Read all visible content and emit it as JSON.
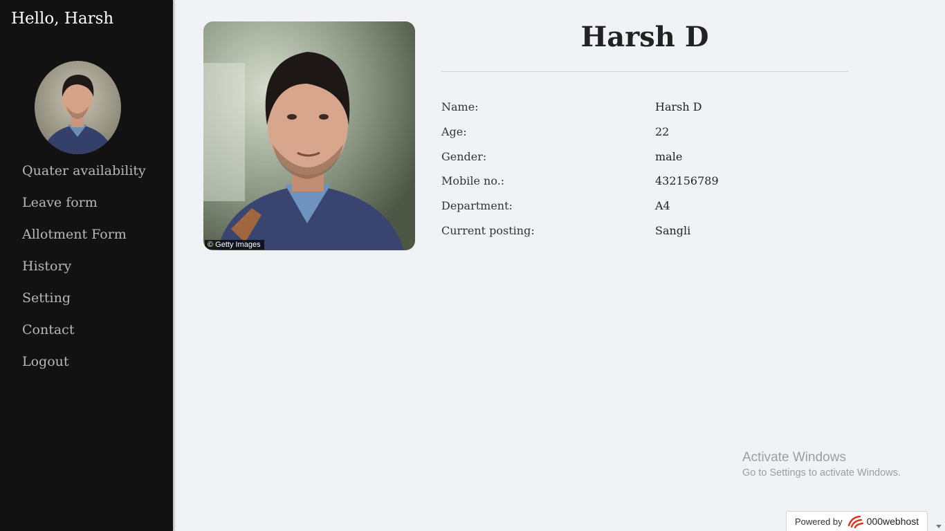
{
  "sidebar": {
    "greeting": "Hello, Harsh",
    "avatar_icon": "user-avatar-photo",
    "nav_items": [
      {
        "label": "Quater availability"
      },
      {
        "label": "Leave form"
      },
      {
        "label": "Allotment Form"
      },
      {
        "label": "History"
      },
      {
        "label": "Setting"
      },
      {
        "label": "Contact"
      },
      {
        "label": "Logout"
      }
    ]
  },
  "profile": {
    "name": "Harsh D",
    "photo_credit": "© Getty Images",
    "details": [
      {
        "label": "Name:",
        "value": "Harsh D"
      },
      {
        "label": "Age:",
        "value": "22"
      },
      {
        "label": "Gender:",
        "value": "male"
      },
      {
        "label": "Mobile no.:",
        "value": "432156789"
      },
      {
        "label": "Department:",
        "value": "A4"
      },
      {
        "label": "Current posting:",
        "value": "Sangli"
      }
    ]
  },
  "watermark": {
    "title": "Activate Windows",
    "subtitle": "Go to Settings to activate Windows."
  },
  "footer": {
    "powered_by": "Powered by",
    "brand": "000webhost",
    "brand_icon": "000webhost-logo-icon"
  },
  "colors": {
    "sidebar_bg": "#121212",
    "page_bg": "#f0f2f6",
    "nav_text": "#b8b8b8",
    "brand_accent": "#e0311b"
  }
}
